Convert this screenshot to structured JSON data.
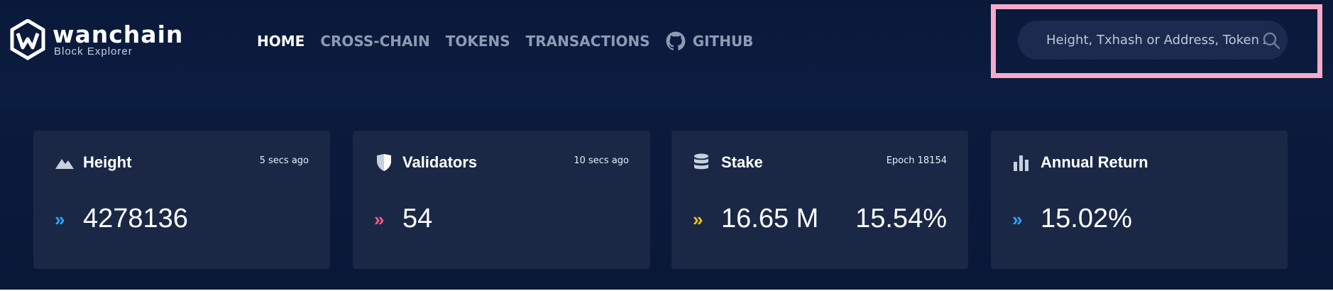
{
  "brand": {
    "name": "wanchain",
    "subtitle": "Block Explorer"
  },
  "nav": {
    "items": [
      {
        "label": "HOME",
        "active": true
      },
      {
        "label": "CROSS-CHAIN",
        "active": false
      },
      {
        "label": "TOKENS",
        "active": false
      },
      {
        "label": "TRANSACTIONS",
        "active": false
      },
      {
        "label": "GITHUB",
        "active": false,
        "icon": "github-icon"
      }
    ]
  },
  "search": {
    "placeholder": "Height, Txhash or Address, Token Add",
    "value": "",
    "icon": "search-icon",
    "highlight_color": "#f6aac8"
  },
  "cards": [
    {
      "title": "Height",
      "icon": "mountain-icon",
      "meta": "5 secs ago",
      "value": "4278136",
      "chevron_color": "#2aa7ff"
    },
    {
      "title": "Validators",
      "icon": "shield-icon",
      "meta": "10 secs ago",
      "value": "54",
      "chevron_color": "#ff5c7c"
    },
    {
      "title": "Stake",
      "icon": "database-icon",
      "meta": "Epoch 18154",
      "value": "16.65 M",
      "value2": "15.54%",
      "chevron_color": "#f2c11a"
    },
    {
      "title": "Annual Return",
      "icon": "bar-chart-icon",
      "value": "15.02%",
      "chevron_color": "#2aa7ff"
    }
  ],
  "chevron_glyph": "»"
}
